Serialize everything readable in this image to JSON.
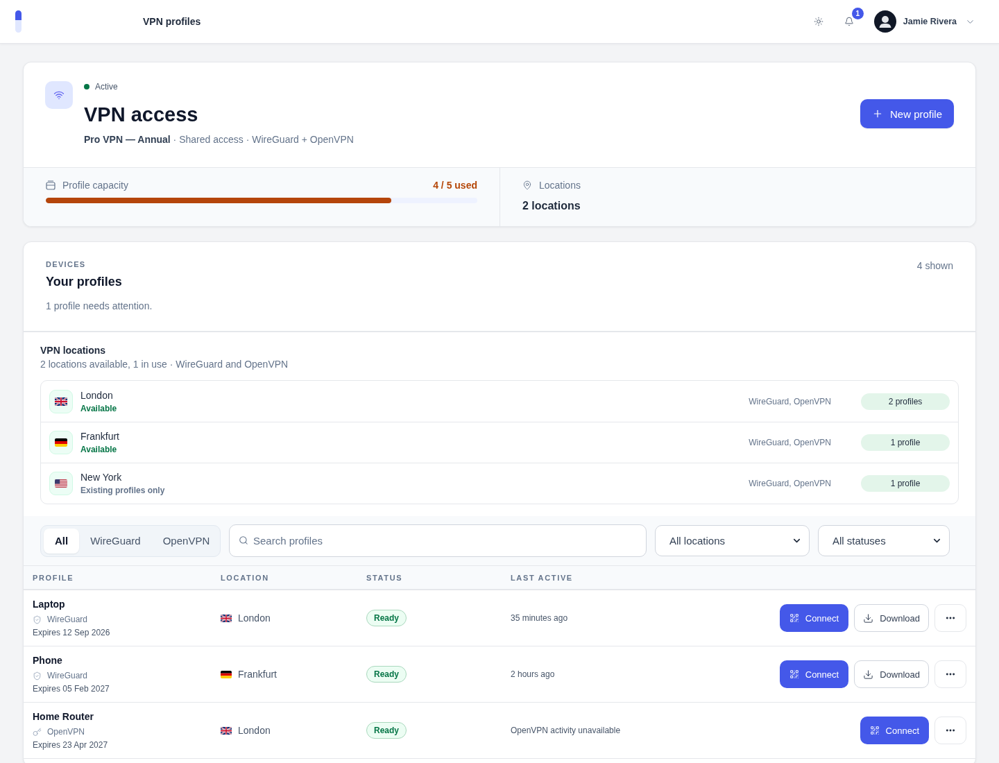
{
  "top_bar": {
    "title": "VPN profiles",
    "notifications": {
      "count": "1"
    },
    "user": {
      "name": "Jamie Rivera"
    }
  },
  "plan": {
    "status": {
      "label": "Active",
      "active": true
    },
    "title": "VPN access",
    "subtitle": "**Pro VPN — Annual** · Shared access · WireGuard + OpenVPN",
    "primary_action": {
      "label": "New profile"
    },
    "capacity": {
      "label": "Profile capacity",
      "reading": "4 / 5 used",
      "level": 0.8
    },
    "locations": {
      "label": "Locations",
      "value": "2 locations"
    }
  },
  "profiles": {
    "eyebrow": "DEVICES",
    "title": "Your profiles",
    "note": "1 profile needs attention.",
    "count": "4 shown",
    "vpn_locations": {
      "title": "VPN locations",
      "subtitle": "2 locations available, 1 in use · WireGuard and OpenVPN",
      "items": [
        {
          "name": "London",
          "kind": "gb",
          "status": "Available",
          "available": true,
          "protocols": "WireGuard, OpenVPN",
          "profiles": "2 profiles"
        },
        {
          "name": "Frankfurt",
          "kind": "de",
          "status": "Available",
          "available": true,
          "protocols": "WireGuard, OpenVPN",
          "profiles": "1 profile"
        },
        {
          "name": "New York",
          "kind": "us",
          "status": "Existing profiles only",
          "available": false,
          "protocols": "WireGuard, OpenVPN",
          "profiles": "1 profile"
        }
      ]
    },
    "filters": {
      "tabs": [
        {
          "label": "All",
          "selected": true
        },
        {
          "label": "WireGuard",
          "selected": false
        },
        {
          "label": "OpenVPN",
          "selected": false
        }
      ],
      "search": {
        "placeholder": "Search profiles"
      },
      "location_select": {
        "value": "All locations"
      },
      "status_select": {
        "value": "All statuses"
      }
    },
    "table": {
      "columns": [
        "PROFILE",
        "LOCATION",
        "STATUS",
        "LAST ACTIVE"
      ],
      "rows": [
        {
          "name": "Laptop",
          "kind": "wireguard",
          "protocol": "WireGuard",
          "expires": "Expires 12 Sep 2026",
          "location": {
            "name": "London",
            "kind": "gb"
          },
          "status": {
            "label": "Ready",
            "kind": "ready"
          },
          "last_active": "35 minutes ago",
          "actions": [
            {
              "kind": "connect",
              "label": "Connect"
            },
            {
              "kind": "download",
              "label": "Download"
            },
            {
              "kind": "more"
            }
          ]
        },
        {
          "name": "Phone",
          "kind": "wireguard",
          "protocol": "WireGuard",
          "expires": "Expires 05 Feb 2027",
          "location": {
            "name": "Frankfurt",
            "kind": "de"
          },
          "status": {
            "label": "Ready",
            "kind": "ready"
          },
          "last_active": "2 hours ago",
          "actions": [
            {
              "kind": "connect",
              "label": "Connect"
            },
            {
              "kind": "download",
              "label": "Download"
            },
            {
              "kind": "more"
            }
          ]
        },
        {
          "name": "Home Router",
          "kind": "openvpn",
          "protocol": "OpenVPN",
          "expires": "Expires 23 Apr 2027",
          "location": {
            "name": "London",
            "kind": "gb"
          },
          "status": {
            "label": "Ready",
            "kind": "ready"
          },
          "last_active": "OpenVPN activity unavailable",
          "actions": [
            {
              "kind": "connect",
              "label": "Connect"
            },
            {
              "kind": "more"
            }
          ]
        }
      ]
    }
  }
}
